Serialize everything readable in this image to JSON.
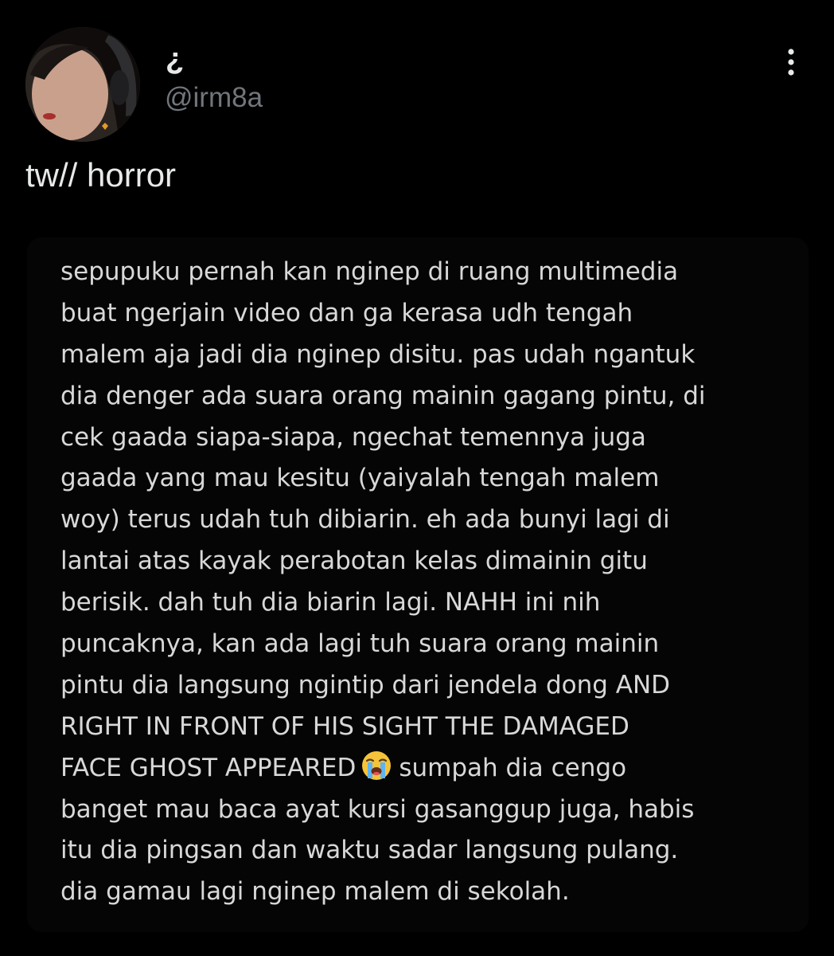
{
  "post": {
    "author": {
      "display_name": "¿",
      "handle": "@irm8a",
      "avatar_icon": "profile-photo"
    },
    "text": "tw// horror",
    "menu_icon": "more-vertical-icon",
    "image_text": {
      "lines": [
        "sepupuku pernah kan nginep di ruang multimedia",
        "buat ngerjain video dan ga kerasa udh tengah",
        "malem aja jadi dia nginep disitu. pas udah ngantuk",
        "dia denger ada suara orang mainin gagang pintu, di",
        "cek gaada siapa-siapa, ngechat temennya juga",
        "gaada yang mau kesitu (yaiyalah tengah malem",
        "woy) terus udah tuh dibiarin. eh ada bunyi lagi di",
        "lantai atas kayak perabotan kelas dimainin gitu",
        "berisik. dah tuh dia biarin lagi. NAHH ini nih",
        "puncaknya, kan ada lagi tuh suara orang mainin",
        "pintu dia langsung ngintip dari jendela dong AND",
        "RIGHT IN FRONT OF HIS SIGHT THE DAMAGED"
      ],
      "line_13_before_emoji": "FACE GHOST APPEARED",
      "line_13_emoji_icon": "loudly-crying-face-icon",
      "line_13_after_emoji": "sumpah dia cengo",
      "lines_end": [
        "banget mau baca ayat kursi gasanggup juga, habis",
        "itu dia pingsan dan waktu sadar langsung pulang.",
        "dia gamau lagi nginep malem di sekolah."
      ]
    }
  },
  "colors": {
    "background": "#000000",
    "primary_text": "#e7e9ea",
    "secondary_text": "#71767b",
    "image_text": "#d8d8d8"
  }
}
